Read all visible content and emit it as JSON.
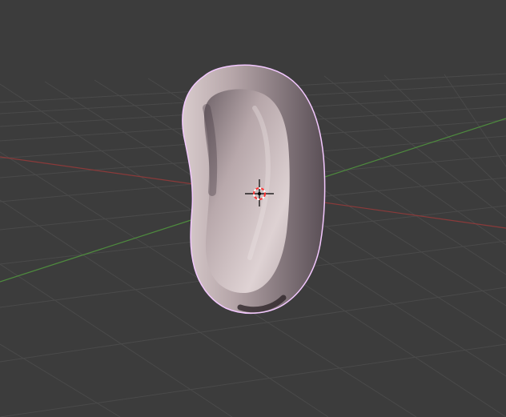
{
  "app": {
    "view": "3d-viewport"
  },
  "viewport": {
    "background_color": "#3c3c3c",
    "grid_color": "#4a4a4a",
    "axis_x_color": "#8a3a3a",
    "axis_y_color": "#4e8a3e"
  },
  "object": {
    "shape": "earpiece-mesh",
    "selected": true,
    "outline_color": "#f3c8ff",
    "surface_color_light": "#d7c7c8",
    "surface_color_mid": "#a7969a",
    "surface_color_dark": "#4a3f45"
  },
  "cursor_3d": {
    "icon": "3d-cursor-icon",
    "ring_colors": [
      "#ff3333",
      "#ffffff"
    ],
    "crosshair_color": "#000000"
  }
}
